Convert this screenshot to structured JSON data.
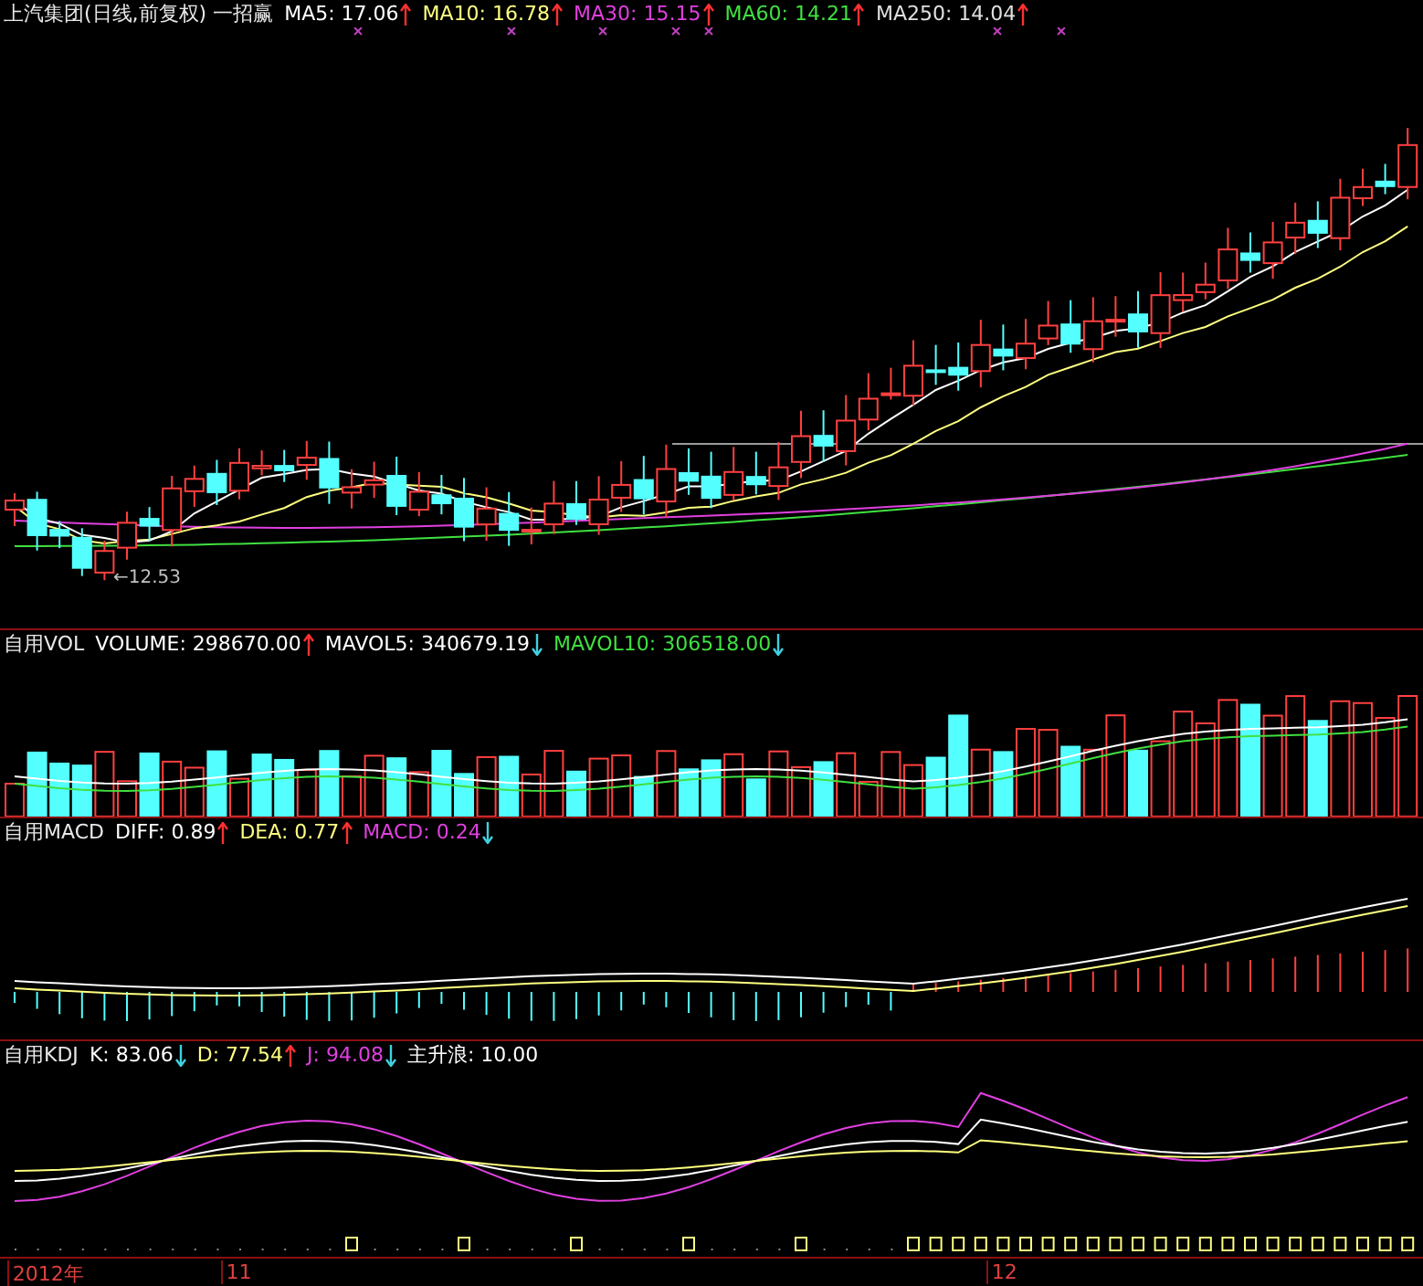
{
  "price_panel": {
    "title": "上汽集团(日线,前复权) 一招赢",
    "indicators": [
      {
        "label": "MA5: 17.06",
        "rising": true,
        "color": "#ffffff"
      },
      {
        "label": "MA10: 16.78",
        "rising": true,
        "color": "#ffff80"
      },
      {
        "label": "MA30: 15.15",
        "rising": true,
        "color": "#e040e0"
      },
      {
        "label": "MA60: 14.21",
        "rising": true,
        "color": "#40e040"
      },
      {
        "label": "MA250: 14.04",
        "rising": true,
        "color": "#e0e0e0"
      }
    ],
    "low_label": "←12.53"
  },
  "volume_panel": {
    "title": "自用VOL",
    "indicators": [
      {
        "label": "VOLUME: 298670.00",
        "rising": true,
        "color": "#ffffff"
      },
      {
        "label": "MAVOL5: 340679.19",
        "rising": false,
        "color": "#ffffff"
      },
      {
        "label": "MAVOL10: 306518.00",
        "rising": false,
        "color": "#40e040"
      }
    ]
  },
  "macd_panel": {
    "title": "自用MACD",
    "indicators": [
      {
        "label": "DIFF: 0.89",
        "rising": true,
        "color": "#ffffff"
      },
      {
        "label": "DEA: 0.77",
        "rising": true,
        "color": "#ffff80"
      },
      {
        "label": "MACD: 0.24",
        "rising": false,
        "color": "#e040e0"
      }
    ]
  },
  "kdj_panel": {
    "title": "自用KDJ",
    "indicators": [
      {
        "label": "K: 83.06",
        "rising": false,
        "color": "#ffffff"
      },
      {
        "label": "D: 77.54",
        "rising": true,
        "color": "#ffff80"
      },
      {
        "label": "J: 94.08",
        "rising": false,
        "color": "#e040e0"
      },
      {
        "label": "主升浪: 10.00",
        "color": "#ffffff"
      }
    ]
  },
  "time_axis": {
    "labels": [
      "2012年",
      "11",
      "12"
    ]
  }
}
